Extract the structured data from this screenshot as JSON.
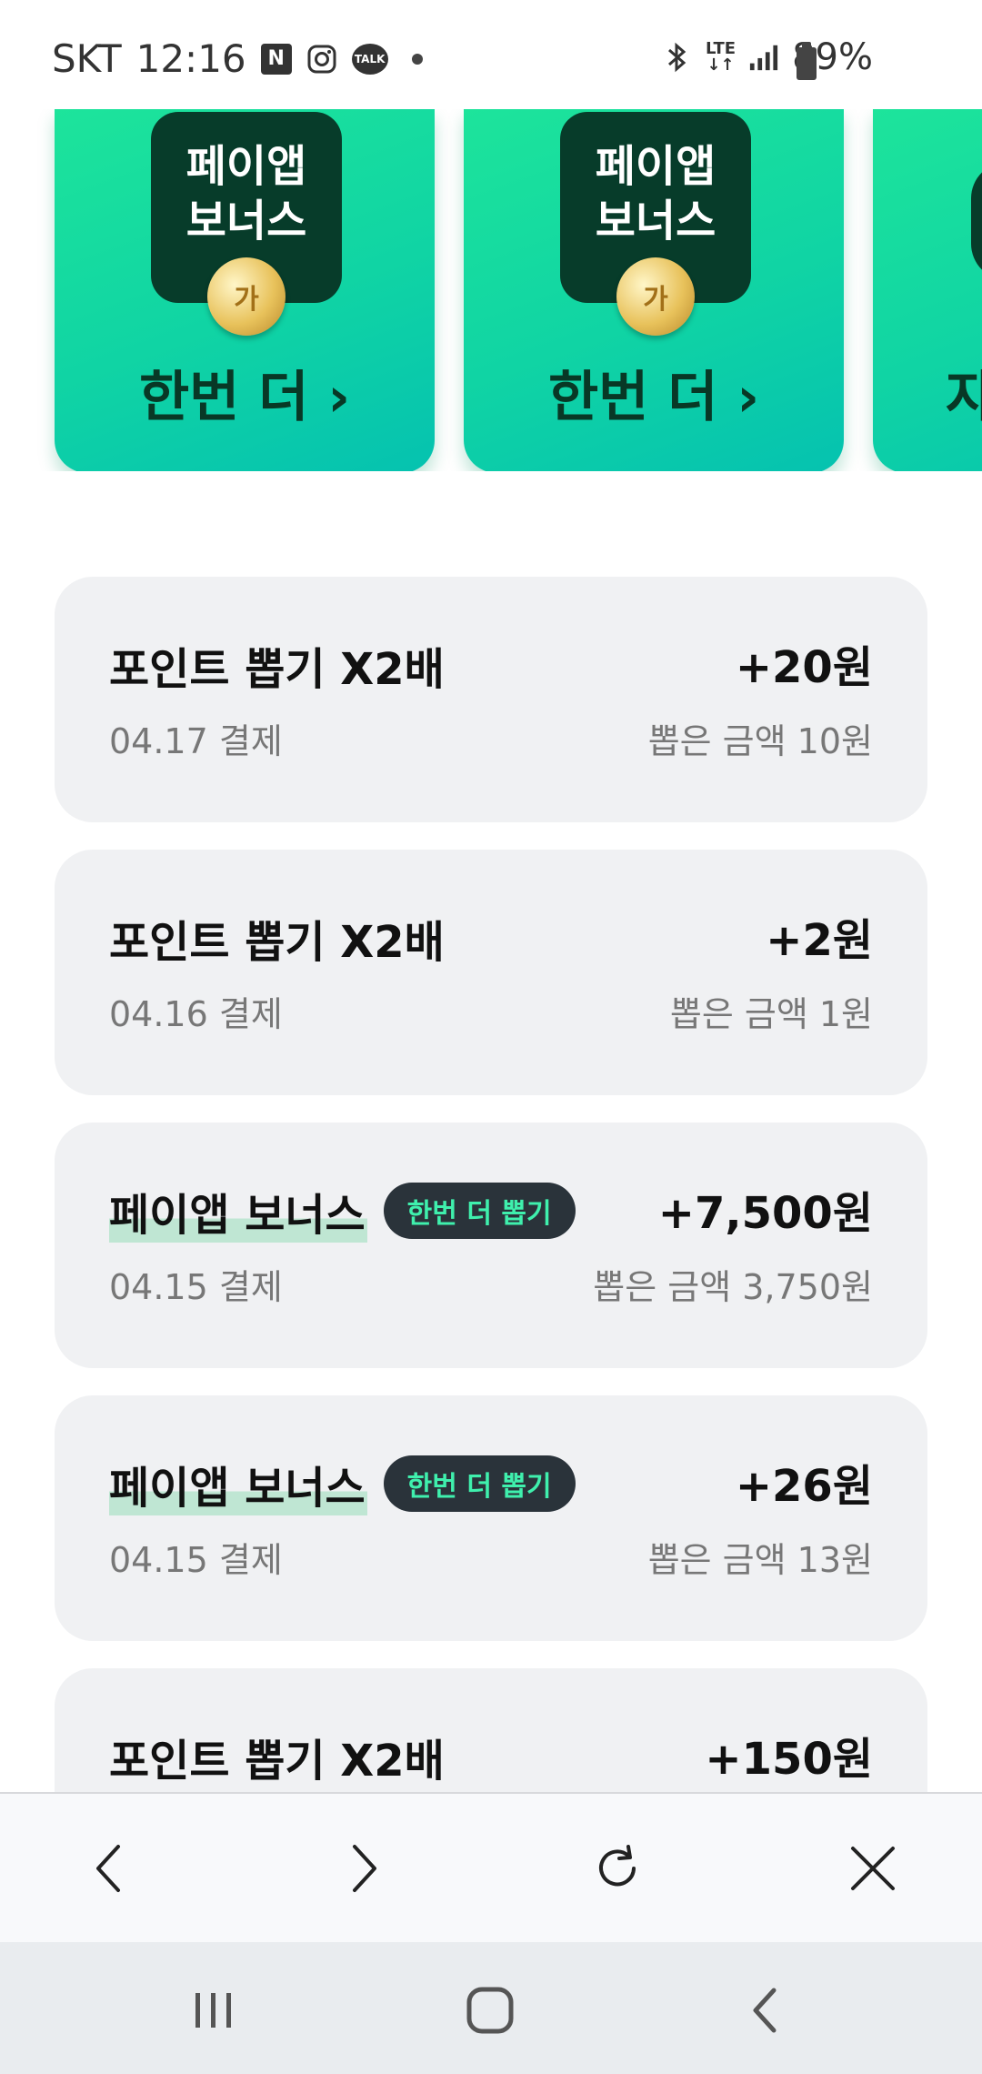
{
  "status_bar": {
    "carrier": "SKT",
    "time": "12:16",
    "notif_n": "N",
    "notif_talk": "TALK",
    "network": "LTE",
    "battery": "89%"
  },
  "banners": [
    {
      "logo_line1": "페이앱",
      "logo_line2": "보너스",
      "coin": "가",
      "cta": "한번 더 ›"
    },
    {
      "logo_line1": "페이앱",
      "logo_line2": "보너스",
      "coin": "가",
      "cta": "한번 더 ›"
    },
    {
      "cta": "자"
    }
  ],
  "history": [
    {
      "title": "포인트 뽑기 X2배",
      "amount": "+20원",
      "date": "04.17 결제",
      "picked": "뽑은 금액 10원"
    },
    {
      "title": "포인트 뽑기 X2배",
      "amount": "+2원",
      "date": "04.16 결제",
      "picked": "뽑은 금액 1원"
    },
    {
      "title": "페이앱 보너스",
      "badge": "한번 더 뽑기",
      "amount": "+7,500원",
      "date": "04.15 결제",
      "picked": "뽑은 금액 3,750원"
    },
    {
      "title": "페이앱 보너스",
      "badge": "한번 더 뽑기",
      "amount": "+26원",
      "date": "04.15 결제",
      "picked": "뽑은 금액 13원"
    },
    {
      "title": "포인트 뽑기 X2배",
      "amount": "+150원"
    }
  ],
  "toolbar": {
    "back_icon": "chevron-left-icon",
    "forward_icon": "chevron-right-icon",
    "reload_icon": "reload-icon",
    "close_icon": "close-icon"
  },
  "system_nav": {
    "recent_icon": "recent-apps-icon",
    "home_icon": "home-icon",
    "back_icon": "back-icon"
  },
  "colors": {
    "banner_green": "#1de49b",
    "badge_bg": "#2a333a",
    "badge_text": "#3ff0ad",
    "card_bg": "#f0f1f3"
  }
}
